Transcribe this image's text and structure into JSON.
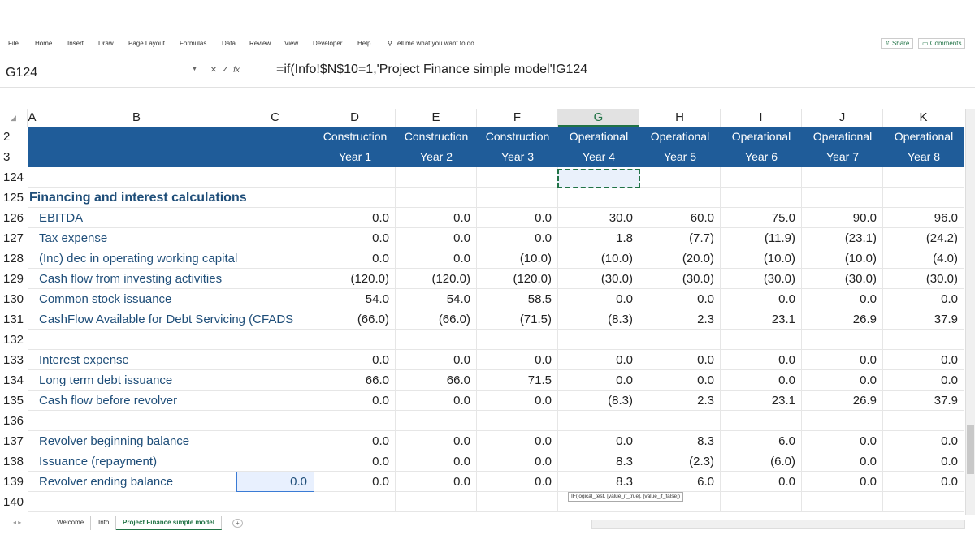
{
  "ribbon": {
    "tabs": [
      "File",
      "Home",
      "Insert",
      "Draw",
      "Page Layout",
      "Formulas",
      "Data",
      "Review",
      "View",
      "Developer",
      "Help"
    ],
    "tell_me": "Tell me what you want to do",
    "share": "Share",
    "comments": "Comments"
  },
  "formula_bar": {
    "name_box": "G124",
    "cancel": "✕",
    "enter": "✓",
    "fx": "fx",
    "formula": "=if(Info!$N$10=1,'Project Finance simple model'!G124"
  },
  "columns": [
    "A",
    "B",
    "C",
    "D",
    "E",
    "F",
    "G",
    "H",
    "I",
    "J",
    "K"
  ],
  "header_rows": {
    "row2": {
      "num": "2",
      "labels": [
        "Construction",
        "Construction",
        "Construction",
        "Operational",
        "Operational",
        "Operational",
        "Operational",
        "Operational"
      ]
    },
    "row3": {
      "num": "3",
      "labels": [
        "Year 1",
        "Year 2",
        "Year 3",
        "Year 4",
        "Year 5",
        "Year 6",
        "Year 7",
        "Year 8"
      ]
    }
  },
  "rows": [
    {
      "num": "124",
      "label": "",
      "values": [
        "",
        "",
        "",
        "",
        "",
        "",
        "",
        ""
      ]
    },
    {
      "num": "125",
      "label": "Financing and interest calculations",
      "values": [
        "",
        "",
        "",
        "",
        "",
        "",
        "",
        ""
      ]
    },
    {
      "num": "126",
      "label": "EBITDA",
      "values": [
        "0.0",
        "0.0",
        "0.0",
        "30.0",
        "60.0",
        "75.0",
        "90.0",
        "96.0"
      ]
    },
    {
      "num": "127",
      "label": "Tax expense",
      "values": [
        "0.0",
        "0.0",
        "0.0",
        "1.8",
        "(7.7)",
        "(11.9)",
        "(23.1)",
        "(24.2)"
      ]
    },
    {
      "num": "128",
      "label": "(Inc) dec in operating working capital",
      "values": [
        "0.0",
        "0.0",
        "(10.0)",
        "(10.0)",
        "(20.0)",
        "(10.0)",
        "(10.0)",
        "(4.0)"
      ]
    },
    {
      "num": "129",
      "label": "Cash flow from investing activities",
      "values": [
        "(120.0)",
        "(120.0)",
        "(120.0)",
        "(30.0)",
        "(30.0)",
        "(30.0)",
        "(30.0)",
        "(30.0)"
      ]
    },
    {
      "num": "130",
      "label": "Common stock issuance",
      "values": [
        "54.0",
        "54.0",
        "58.5",
        "0.0",
        "0.0",
        "0.0",
        "0.0",
        "0.0"
      ]
    },
    {
      "num": "131",
      "label": " CashFlow Available for Debt Servicing (CFADS",
      "values": [
        "(66.0)",
        "(66.0)",
        "(71.5)",
        "(8.3)",
        "2.3",
        "23.1",
        "26.9",
        "37.9"
      ]
    },
    {
      "num": "132",
      "label": "",
      "values": [
        "",
        "",
        "",
        "",
        "",
        "",
        "",
        ""
      ]
    },
    {
      "num": "133",
      "label": "Interest expense",
      "values": [
        "0.0",
        "0.0",
        "0.0",
        "0.0",
        "0.0",
        "0.0",
        "0.0",
        "0.0"
      ]
    },
    {
      "num": "134",
      "label": "Long term debt issuance",
      "values": [
        "66.0",
        "66.0",
        "71.5",
        "0.0",
        "0.0",
        "0.0",
        "0.0",
        "0.0"
      ]
    },
    {
      "num": "135",
      "label": "Cash flow before revolver",
      "values": [
        "0.0",
        "0.0",
        "0.0",
        "(8.3)",
        "2.3",
        "23.1",
        "26.9",
        "37.9"
      ]
    },
    {
      "num": "136",
      "label": "",
      "values": [
        "",
        "",
        "",
        "",
        "",
        "",
        "",
        ""
      ]
    },
    {
      "num": "137",
      "label": "Revolver beginning balance",
      "values": [
        "0.0",
        "0.0",
        "0.0",
        "0.0",
        "8.3",
        "6.0",
        "0.0",
        "0.0"
      ]
    },
    {
      "num": "138",
      "label": "Issuance (repayment)",
      "values": [
        "0.0",
        "0.0",
        "0.0",
        "8.3",
        "(2.3)",
        "(6.0)",
        "0.0",
        "0.0"
      ]
    },
    {
      "num": "139",
      "label": "Revolver ending balance",
      "c_value": "0.0",
      "values": [
        "0.0",
        "0.0",
        "0.0",
        "8.3",
        "6.0",
        "0.0",
        "0.0",
        "0.0"
      ]
    },
    {
      "num": "140",
      "label": "",
      "values": [
        "",
        "",
        "",
        "",
        "",
        "",
        "",
        ""
      ]
    }
  ],
  "tooltip": "IF(logical_test, [value_if_true], [value_if_false])",
  "sheet_tabs": [
    "Welcome",
    "Info",
    "Project Finance simple model"
  ],
  "add_sheet": "+"
}
